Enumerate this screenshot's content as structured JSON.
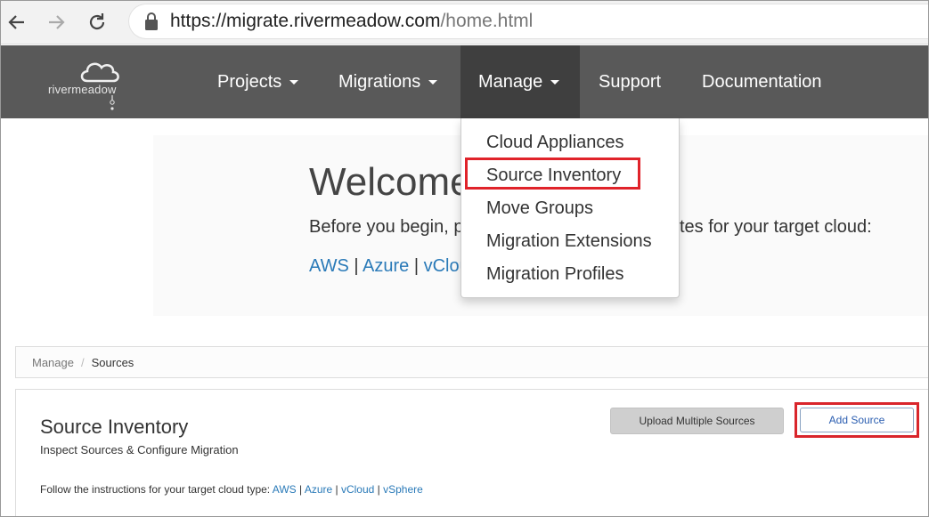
{
  "browser": {
    "url_main": "https://migrate.rivermeadow.com",
    "url_path": "/home.html"
  },
  "navbar": {
    "logo_text": "rivermeadow",
    "items": [
      {
        "label": "Projects"
      },
      {
        "label": "Migrations"
      },
      {
        "label": "Manage"
      },
      {
        "label": "Support"
      },
      {
        "label": "Documentation"
      }
    ]
  },
  "dropdown": {
    "items": [
      {
        "label": "Cloud Appliances"
      },
      {
        "label": "Source Inventory"
      },
      {
        "label": "Move Groups"
      },
      {
        "label": "Migration Extensions"
      },
      {
        "label": "Migration Profiles"
      }
    ]
  },
  "welcome": {
    "title": "Welcome",
    "before_text": "Before you begin, p",
    "before_tail": "tes for your target cloud:",
    "links": [
      "AWS",
      "Azure",
      "vClou"
    ]
  },
  "breadcrumb": {
    "parent": "Manage",
    "separator": "/",
    "current": "Sources"
  },
  "panel": {
    "title": "Source Inventory",
    "subtitle": "Inspect Sources & Configure Migration",
    "follow_text": "Follow the instructions for your target cloud type:",
    "follow_links": [
      "AWS",
      "Azure",
      "vCloud",
      "vSphere"
    ],
    "upload_button": "Upload Multiple Sources",
    "add_button": "Add Source"
  },
  "colors": {
    "navbar_bg": "#595959",
    "navbar_active": "#3f3f3f",
    "highlight_red": "#e0232a",
    "link_blue": "#2a7ab8"
  }
}
